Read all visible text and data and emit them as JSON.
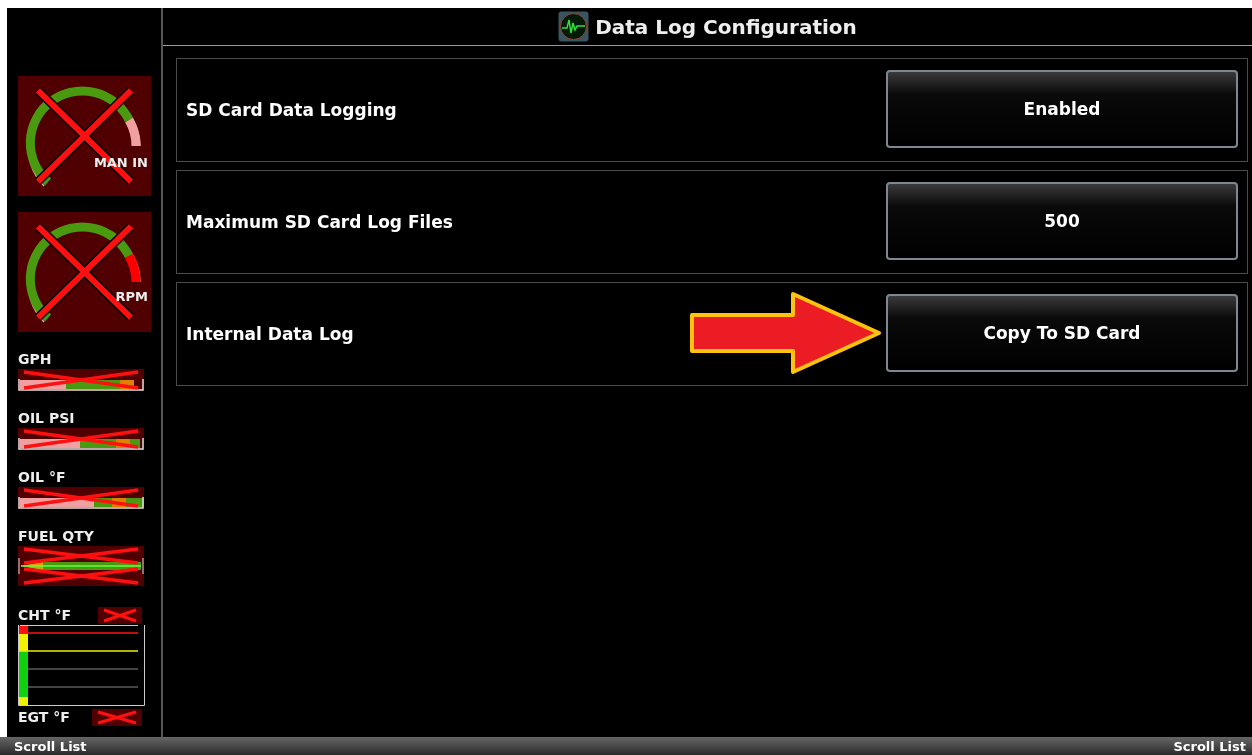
{
  "title": "Data Log Configuration",
  "gauges": [
    {
      "kind": "dial",
      "label": "MAN IN",
      "invalid": true,
      "color": "#f0a0a0"
    },
    {
      "kind": "dial",
      "label": "RPM",
      "invalid": true,
      "color": "#ff0000"
    },
    {
      "kind": "bar",
      "label": "GPH",
      "invalid": true
    },
    {
      "kind": "bar",
      "label": "OIL PSI",
      "invalid": true
    },
    {
      "kind": "bar",
      "label": "OIL °F",
      "invalid": true
    },
    {
      "kind": "tank",
      "label": "FUEL QTY",
      "invalid": true
    },
    {
      "kind": "cht",
      "label": "CHT °F",
      "invalid": true
    },
    {
      "kind": "egt",
      "label": "EGT °F",
      "invalid": true
    }
  ],
  "settings": [
    {
      "label": "SD Card Data Logging",
      "value": "Enabled"
    },
    {
      "label": "Maximum SD Card Log Files",
      "value": "500"
    },
    {
      "label": "Internal Data Log",
      "value": "Copy To SD Card"
    }
  ],
  "softkeys": [
    {
      "label": "Scroll List"
    },
    {
      "label": "Scroll List"
    }
  ]
}
